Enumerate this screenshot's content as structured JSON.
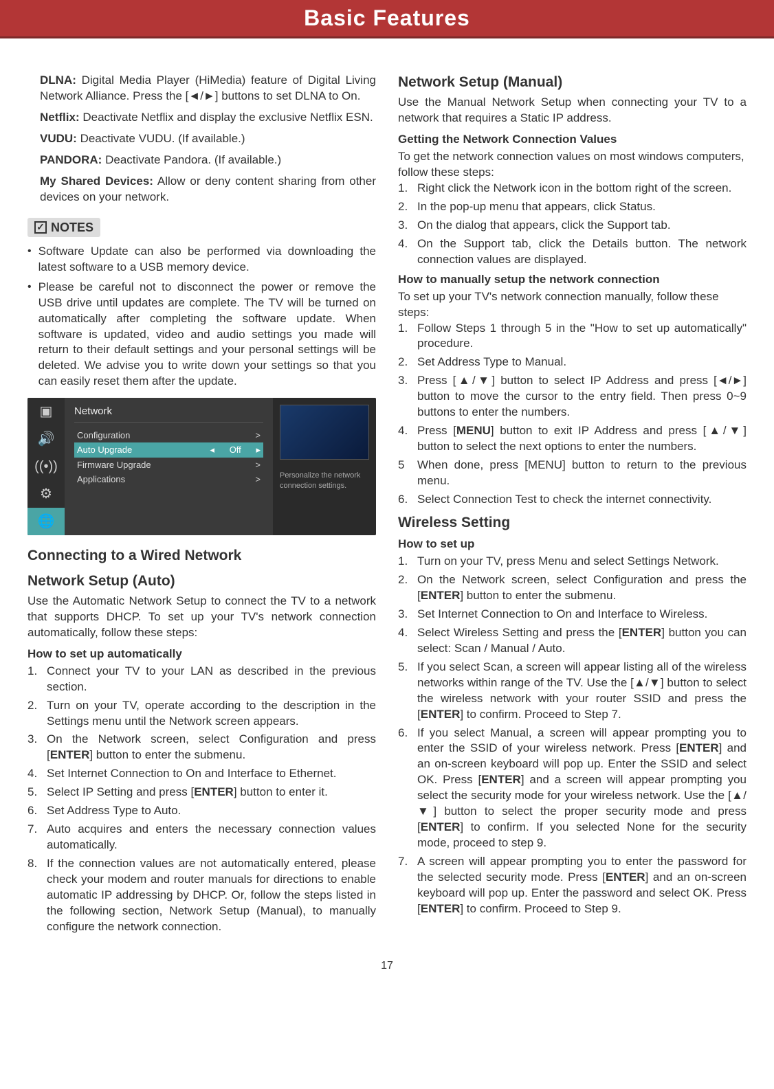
{
  "header": "Basic Features",
  "pageNumber": "17",
  "left": {
    "dlna_label": "DLNA:",
    "dlna_text": " Digital Media Player (HiMedia) feature of Digital Living Network Alliance. Press the [◄/►] buttons to set DLNA to On.",
    "netflix_label": "Netflix:",
    "netflix_text": " Deactivate Netflix and display the exclusive Netflix ESN.",
    "vudu_label": "VUDU:",
    "vudu_text": " Deactivate VUDU. (If available.)",
    "pandora_label": "PANDORA:",
    "pandora_text": " Deactivate Pandora. (If available.)",
    "shared_label": "My Shared Devices:",
    "shared_text": " Allow or deny content sharing from other devices on your network.",
    "notes_label": "NOTES",
    "note1": "Software Update can also be performed via downloading the latest software to a USB memory device.",
    "note2": "Please be careful not to disconnect the power or remove the USB drive until updates are complete. The TV will be turned on automatically after completing the software update. When software is updated, video and audio settings you made will return to their default settings and your personal settings will be deleted. We advise you to write down your settings so that you can easily reset them after the update.",
    "menu": {
      "title": "Network",
      "rows": [
        "Configuration",
        "Auto Upgrade",
        "Firmware Upgrade",
        "Applications"
      ],
      "off": "Off",
      "desc": "Personalize the network connection settings."
    },
    "h_wired": "Connecting to a Wired Network",
    "h_auto": "Network Setup (Auto)",
    "auto_intro": "Use the Automatic Network Setup to connect the TV to a network that supports DHCP. To set up your TV's network connection automatically, follow these steps:",
    "how_auto": "How to set up automatically",
    "auto_steps": [
      "Connect your TV to your LAN as described in the previous section.",
      "Turn on your TV, operate according to the description in the Settings menu until the Network screen appears.",
      "On the Network screen, select Configuration and press [ENTER] button to enter the submenu.",
      "Set Internet Connection to On and Interface to Ethernet.",
      "Select IP Setting and press [ENTER] button to enter it.",
      "Set Address Type to Auto.",
      "Auto acquires and enters the necessary connection values automatically.",
      "If the connection values are not automatically entered, please check your modem and router manuals for directions to enable automatic IP addressing by DHCP. Or, follow the steps listed in the following section, Network Setup (Manual), to manually configure the network connection."
    ]
  },
  "right": {
    "h_manual": "Network Setup (Manual)",
    "manual_intro": "Use the Manual Network Setup when connecting your TV to a network that requires a Static IP address.",
    "h_getvalues": "Getting the Network Connection Values",
    "getvalues_intro": "To get the network connection values on most windows computers, follow these steps:",
    "getvalues_steps": [
      "Right click the Network icon in the bottom right of the screen.",
      "In the pop-up menu that appears, click Status.",
      "On the dialog that appears, click the Support tab.",
      "On the Support tab, click the Details button. The network connection values are displayed."
    ],
    "h_manually": "How to manually setup the network connection",
    "manually_intro": "To set up your TV's network connection manually, follow these steps:",
    "man_step1": "Follow Steps 1 through 5 in the \"How to set up automatically\" procedure.",
    "man_step2": "Set Address Type to Manual.",
    "man_step3": "Press [▲/▼] button to select IP Address and press [◄/►] button to move the cursor to the entry field. Then press 0~9 buttons to enter the numbers.",
    "man_step4a": "Press [",
    "man_step4b": "MENU",
    "man_step4c": "] button to exit IP Address and press [▲/▼] button to select the next options to enter the numbers.",
    "man_step5": "When done, press [MENU] button to return to the previous menu.",
    "man_step6": "Select Connection Test to check the internet connectivity.",
    "h_wireless": "Wireless Setting",
    "h_howsetup": "How to set up",
    "w1": "Turn on your TV, press Menu and select Settings  Network.",
    "w2a": "On the Network screen, select Configuration and press the [",
    "w2b": "ENTER",
    "w2c": "] button to enter the submenu.",
    "w3": "Set Internet Connection to On and Interface to Wireless.",
    "w4a": "Select Wireless Setting and press the [",
    "w4b": "ENTER",
    "w4c": "] button you can select: Scan / Manual / Auto.",
    "w5a": "If you select Scan, a screen will appear listing all of the wireless networks within range of the TV. Use the [▲/▼] button to select the wireless network with your router SSID and press the [",
    "w5b": "ENTER",
    "w5c": "] to confirm. Proceed to Step 7.",
    "w6a": "If you select Manual, a screen will appear prompting you to enter the SSID of your wireless network. Press [",
    "w6b": "ENTER",
    "w6c": "] and an on-screen keyboard will pop up. Enter the SSID and select OK. Press [",
    "w6d": "ENTER",
    "w6e": "] and a screen will appear prompting you select the security mode for your wireless network. Use the [▲/▼] button to select the proper security mode and press [",
    "w6f": "ENTER",
    "w6g": "] to confirm. If you selected None for the security mode, proceed to step 9.",
    "w7a": "A screen will appear prompting you to enter the password for the selected security mode. Press [",
    "w7b": "ENTER",
    "w7c": "] and an on-screen keyboard will pop up. Enter the password and select OK. Press [",
    "w7d": "ENTER",
    "w7e": "] to confirm. Proceed to Step 9."
  }
}
